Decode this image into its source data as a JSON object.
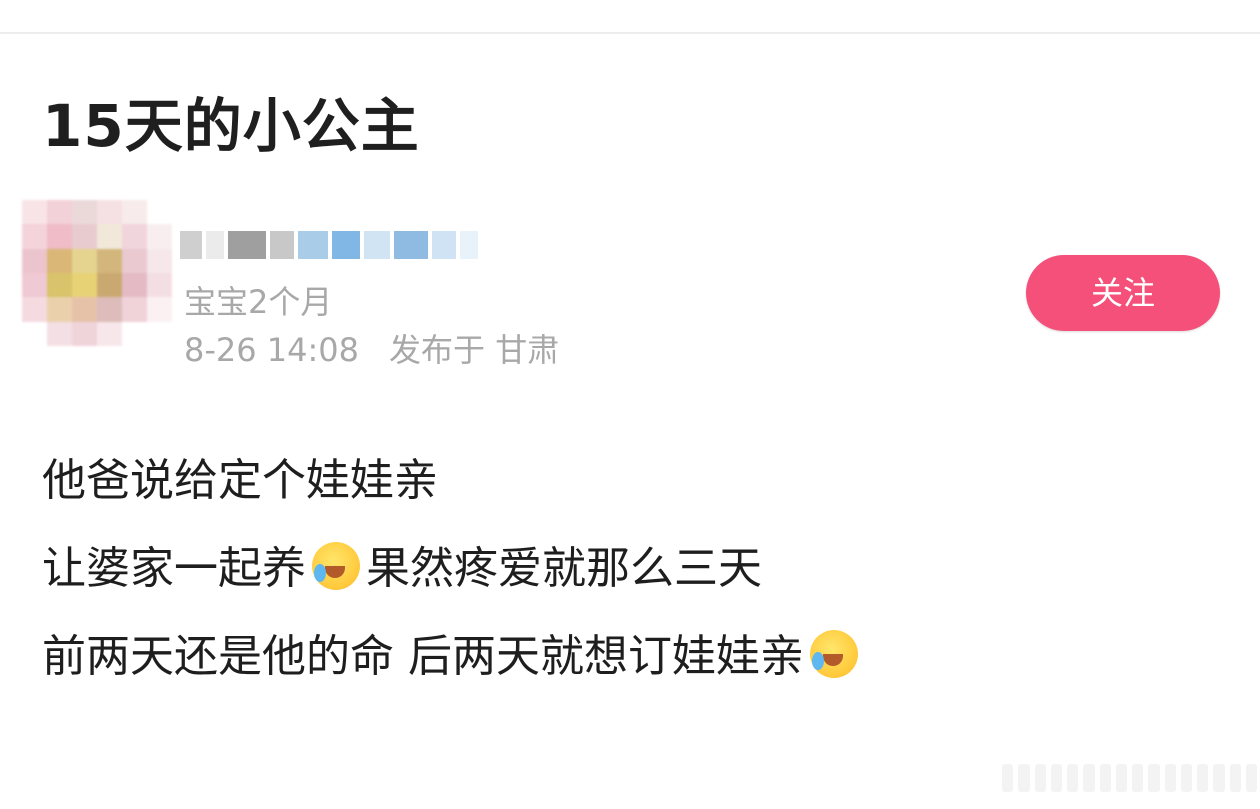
{
  "post": {
    "title": "15天的小公主",
    "author": {
      "age_tag": "宝宝2个月",
      "date": "8-26 14:08",
      "location": "发布于 甘肃"
    },
    "follow_label": "关注",
    "follow_color": "#f4507a",
    "body": {
      "line1": "他爸说给定个娃娃亲",
      "line2a": "让婆家一起养",
      "line2b": "果然疼爱就那么三天",
      "line3": "前两天还是他的命 后两天就想订娃娃亲"
    },
    "emoji": "laughing-crying-face-icon"
  }
}
